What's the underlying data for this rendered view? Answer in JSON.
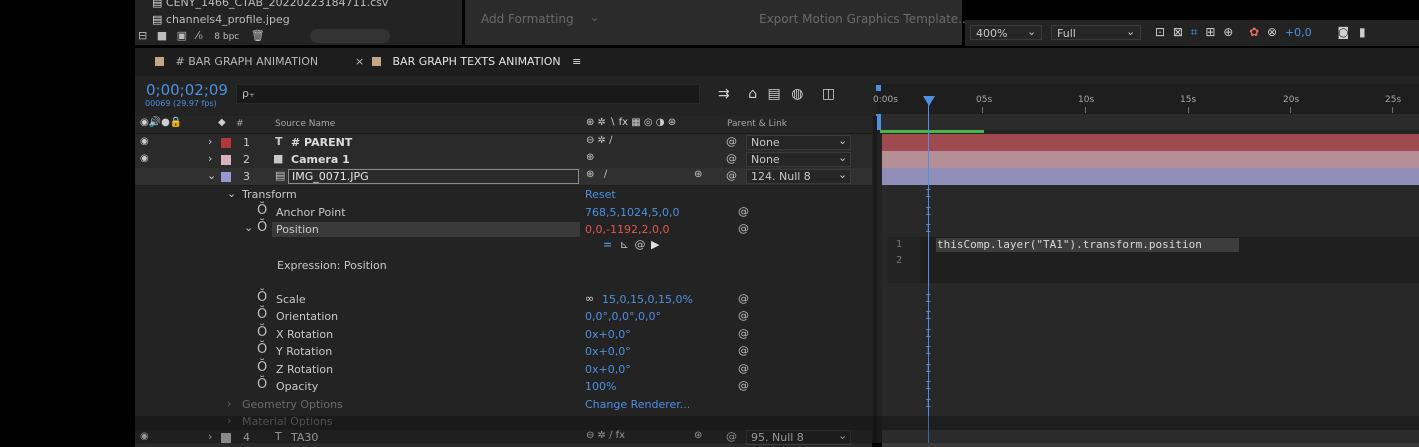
{
  "project": {
    "files": [
      {
        "name": "CENY_1466_CTAB_20220223184711.csv"
      },
      {
        "name": "channels4_profile.jpeg"
      }
    ],
    "bpc": "8 bpc"
  },
  "effects_panel": {
    "add_formatting": "Add Formatting",
    "export_mgt": "Export Motion Graphics Template..."
  },
  "viewer_toolbar": {
    "zoom": "400%",
    "resolution": "Full",
    "exposure": "+0,0"
  },
  "tabs": [
    {
      "label": "# BAR GRAPH ANIMATION",
      "active": false
    },
    {
      "label": "BAR GRAPH TEXTS ANIMATION",
      "active": true
    }
  ],
  "timecode": "0;00;02;09",
  "frame_info": "00069 (29.97 fps)",
  "search_glyph": "ρ₊",
  "columns": {
    "number": "#",
    "source_name": "Source Name",
    "switches": "⊕ ✲ ∖ fx ▦ ◎ ◑ ⊛",
    "parent_link": "Parent & Link"
  },
  "ruler": [
    "0:00s",
    "05s",
    "10s",
    "15s",
    "20s",
    "25s"
  ],
  "layers": [
    {
      "num": "1",
      "type": "T",
      "name": "# PARENT",
      "parent": "None",
      "color": "#b03838"
    },
    {
      "num": "2",
      "type": "■",
      "name": "Camera 1",
      "parent": "None",
      "color": "#d7b2bc"
    },
    {
      "num": "3",
      "type": "▤",
      "name": "IMG_0071.JPG",
      "parent": "124. Null 8",
      "color": "#9a98d2"
    },
    {
      "num": "4",
      "type": "T",
      "name": "TA30",
      "parent": "95. Null 8",
      "color": "#b9b9b9"
    }
  ],
  "transform": {
    "label": "Transform",
    "reset": "Reset",
    "properties": [
      {
        "name": "Anchor Point",
        "value": "768,5,1024,5,0,0"
      },
      {
        "name": "Position",
        "value": "0,0,-1192,2,0,0"
      },
      {
        "name": "Scale",
        "value": "15,0,15,0,15,0%"
      },
      {
        "name": "Orientation",
        "value": "0,0°,0,0°,0,0°"
      },
      {
        "name": "X Rotation",
        "value": "0x+0,0°"
      },
      {
        "name": "Y Rotation",
        "value": "0x+0,0°"
      },
      {
        "name": "Z Rotation",
        "value": "0x+0,0°"
      },
      {
        "name": "Opacity",
        "value": "100%"
      }
    ],
    "expression_label": "Expression: Position",
    "expression_line_numbers": [
      "1",
      "2"
    ],
    "expression_code": "thisComp.layer(\"TA1\").transform.position"
  },
  "geometry_options": "Geometry Options",
  "change_renderer": "Change Renderer...",
  "material_options": "Material Options",
  "colors": {
    "accent_blue": "#4d8fe0",
    "expression_red": "#e0584c",
    "layer1_bar": "#9e4a4f",
    "layer2_bar": "#b58f97",
    "layer3_bar": "#8f8eb8",
    "playhead": "#4d8fe0"
  }
}
